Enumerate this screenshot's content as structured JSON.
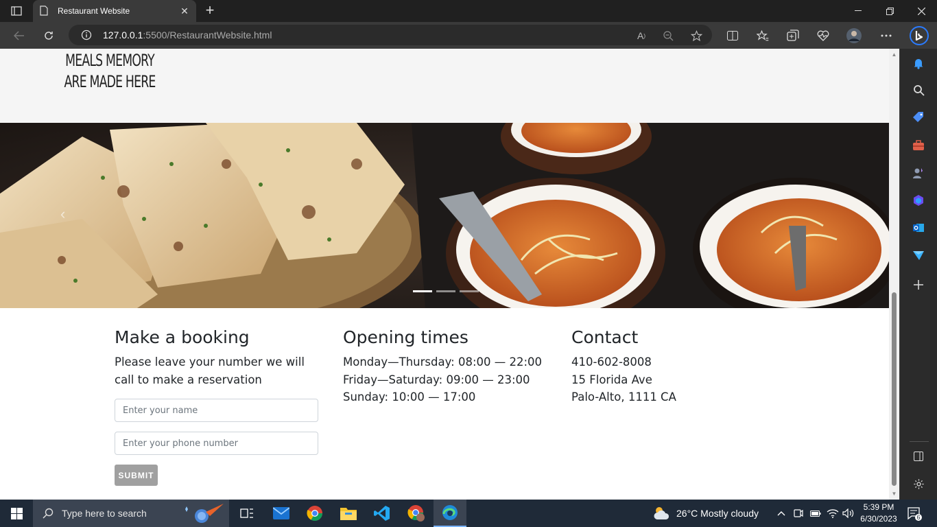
{
  "browser": {
    "tab_title": "Restaurant Website",
    "url_host": "127.0.0.1",
    "url_rest": ":5500/RestaurantWebsite.html"
  },
  "page": {
    "tagline_line1": "MEALS MEMORY",
    "tagline_line2": "ARE MADE HERE",
    "booking": {
      "heading": "Make a booking",
      "description": "Please leave your number we will call to make a reservation",
      "name_placeholder": "Enter your name",
      "phone_placeholder": "Enter your phone number",
      "submit_label": "SUBMIT"
    },
    "hours": {
      "heading": "Opening times",
      "lines": [
        "Monday—Thursday: 08:00 — 22:00",
        "Friday—Saturday: 09:00 — 23:00",
        "Sunday: 10:00 — 17:00"
      ]
    },
    "contact": {
      "heading": "Contact",
      "lines": [
        "410-602-8008",
        "15 Florida Ave",
        "Palo-Alto, 1111 CA"
      ]
    },
    "carousel": {
      "slide_count": 3,
      "active_slide": 1
    }
  },
  "taskbar": {
    "search_placeholder": "Type here to search",
    "weather": "26°C  Mostly cloudy",
    "time": "5:39 PM",
    "date": "6/30/2023",
    "notification_count": "6"
  }
}
